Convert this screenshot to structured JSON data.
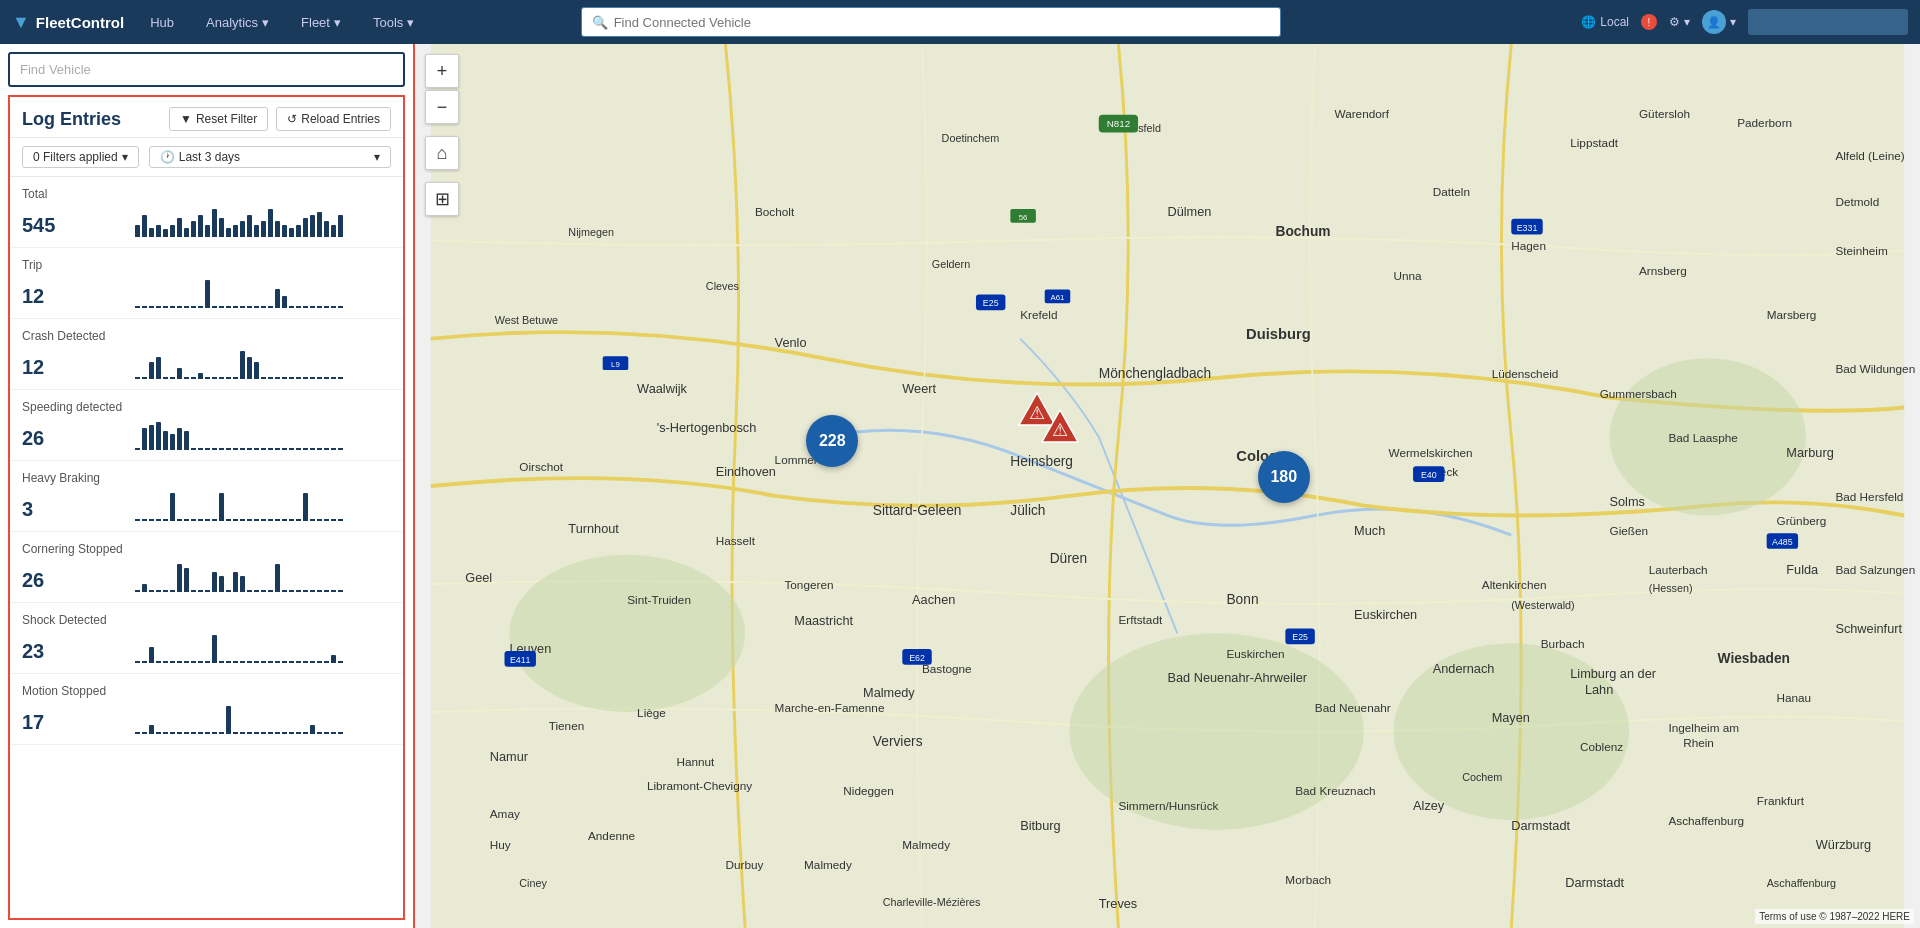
{
  "brand": {
    "name": "FleetControl",
    "icon": "▼"
  },
  "nav": {
    "items": [
      {
        "label": "Hub",
        "has_dropdown": false
      },
      {
        "label": "Analytics",
        "has_dropdown": true
      },
      {
        "label": "Fleet",
        "has_dropdown": true
      },
      {
        "label": "Tools",
        "has_dropdown": true
      }
    ],
    "search_placeholder": "Find Connected Vehicle",
    "locale": "Local",
    "settings_label": "Settings",
    "user_label": "User"
  },
  "left_panel": {
    "find_vehicle_placeholder": "Find Vehicle",
    "log_entries": {
      "title": "Log Entries",
      "reset_filter_label": "Reset Filter",
      "reload_entries_label": "Reload Entries",
      "filters_applied": "0 Filters applied",
      "date_range": "Last 3 days",
      "entries": [
        {
          "name": "Total",
          "count": "545",
          "bars": [
            8,
            14,
            6,
            8,
            5,
            8,
            12,
            6,
            10,
            14,
            8,
            18,
            12,
            6,
            8,
            10,
            14,
            8,
            10,
            18,
            10,
            8,
            6,
            8,
            12,
            14,
            16,
            10,
            8,
            14
          ]
        },
        {
          "name": "Trip",
          "count": "12",
          "bars": [
            0,
            0,
            0,
            0,
            0,
            0,
            0,
            0,
            0,
            0,
            18,
            0,
            0,
            0,
            0,
            0,
            0,
            0,
            0,
            0,
            12,
            8,
            0,
            0,
            0,
            0,
            0,
            0,
            0,
            0
          ]
        },
        {
          "name": "Crash Detected",
          "count": "12",
          "bars": [
            0,
            0,
            6,
            8,
            0,
            0,
            4,
            0,
            0,
            2,
            0,
            0,
            0,
            0,
            0,
            10,
            8,
            6,
            0,
            0,
            0,
            0,
            0,
            0,
            0,
            0,
            0,
            0,
            0,
            0
          ]
        },
        {
          "name": "Speeding detected",
          "count": "26",
          "bars": [
            0,
            14,
            16,
            18,
            12,
            10,
            14,
            12,
            0,
            0,
            0,
            0,
            0,
            0,
            0,
            0,
            0,
            0,
            0,
            0,
            0,
            0,
            0,
            0,
            0,
            0,
            0,
            0,
            0,
            0
          ]
        },
        {
          "name": "Heavy Braking",
          "count": "3",
          "bars": [
            0,
            0,
            0,
            0,
            0,
            4,
            0,
            0,
            0,
            0,
            0,
            0,
            4,
            0,
            0,
            0,
            0,
            0,
            0,
            0,
            0,
            0,
            0,
            0,
            4,
            0,
            0,
            0,
            0,
            0
          ]
        },
        {
          "name": "Cornering Stopped",
          "count": "26",
          "bars": [
            0,
            4,
            0,
            0,
            0,
            0,
            14,
            12,
            0,
            0,
            0,
            10,
            8,
            0,
            10,
            8,
            0,
            0,
            0,
            0,
            14,
            0,
            0,
            0,
            0,
            0,
            0,
            0,
            0,
            0
          ]
        },
        {
          "name": "Shock Detected",
          "count": "23",
          "bars": [
            0,
            0,
            8,
            0,
            0,
            0,
            0,
            0,
            0,
            0,
            0,
            14,
            0,
            0,
            0,
            0,
            0,
            0,
            0,
            0,
            0,
            0,
            0,
            0,
            0,
            0,
            0,
            0,
            4,
            0
          ]
        },
        {
          "name": "Motion Stopped",
          "count": "17",
          "bars": [
            0,
            0,
            4,
            0,
            0,
            0,
            0,
            0,
            0,
            0,
            0,
            0,
            0,
            12,
            0,
            0,
            0,
            0,
            0,
            0,
            0,
            0,
            0,
            0,
            0,
            4,
            0,
            0,
            0,
            0
          ]
        }
      ]
    }
  },
  "map": {
    "clusters": [
      {
        "id": "cluster-228",
        "count": "228",
        "type": "blue",
        "top": "46%",
        "left": "26%",
        "size": 52
      },
      {
        "id": "cluster-180",
        "count": "180",
        "type": "blue",
        "top": "48%",
        "left": "56%",
        "size": 52
      },
      {
        "id": "warning-1",
        "count": "",
        "type": "warning",
        "top": "42%",
        "left": "40%"
      },
      {
        "id": "warning-2",
        "count": "",
        "type": "warning",
        "top": "44%",
        "left": "42%"
      }
    ],
    "attribution": "Terms of use  © 1987–2022 HERE"
  }
}
